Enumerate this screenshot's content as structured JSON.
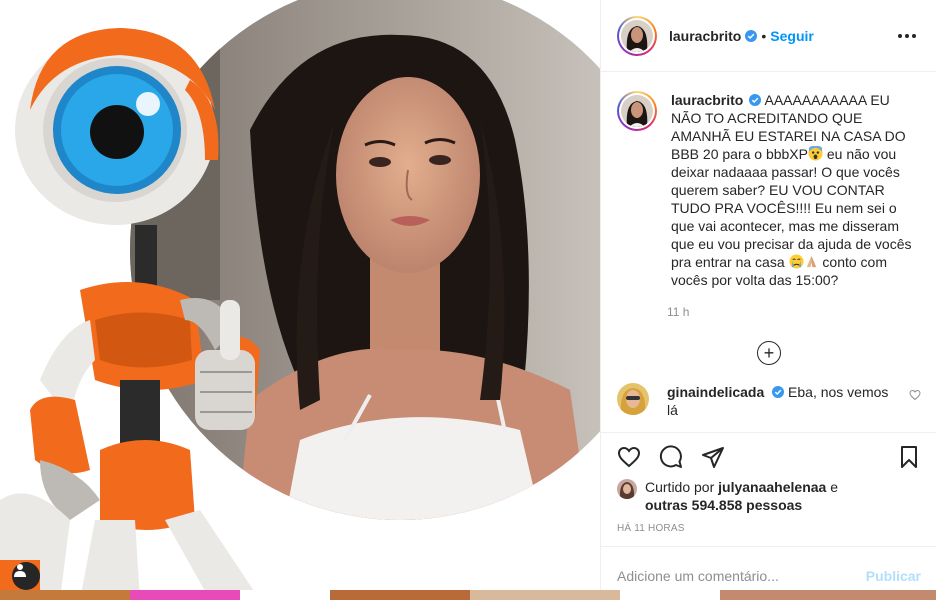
{
  "post": {
    "username": "lauracbrito",
    "separator": "•",
    "follow_label": "Seguir",
    "caption": "AAAAAAAAAAA EU NÃO TO ACREDITANDO QUE AMANHÃ EU ESTAREI NA CASA DO BBB 20 para o bbbXP",
    "caption_2": " eu não vou deixar nadaaaa passar! O que vocês querem saber? EU VOU CONTAR TUDO PRA VOCÊS!!!! Eu nem sei o que vai acontecer, mas me disseram que eu vou precisar da ajuda de vocês pra entrar na casa ",
    "caption_3": " conto com vocês por volta das 15:00?",
    "caption_time": "11 h"
  },
  "comment": {
    "username": "ginaindelicada",
    "text": "Eba, nos vemos lá"
  },
  "likes": {
    "prefix": "Curtido por",
    "user": "julyanaahelenaa",
    "joiner": "e",
    "others": "outras 594.858 pessoas"
  },
  "time_ago": "HÁ 11 HORAS",
  "add_comment": {
    "placeholder": "Adicione um comentário...",
    "publish_label": "Publicar"
  },
  "icons": {
    "verified": "verified-badge-icon",
    "more": "more-options-icon",
    "load_more": "plus-circle-icon",
    "like": "heart-icon",
    "comment": "comment-icon",
    "share": "paper-plane-icon",
    "save": "bookmark-icon",
    "user_tag": "user-tag-icon"
  },
  "colors": {
    "accent": "#0095f6",
    "publish_disabled": "#b2dffc",
    "robot_orange": "#f26a1b",
    "eye_blue": "#2aa7e8"
  }
}
